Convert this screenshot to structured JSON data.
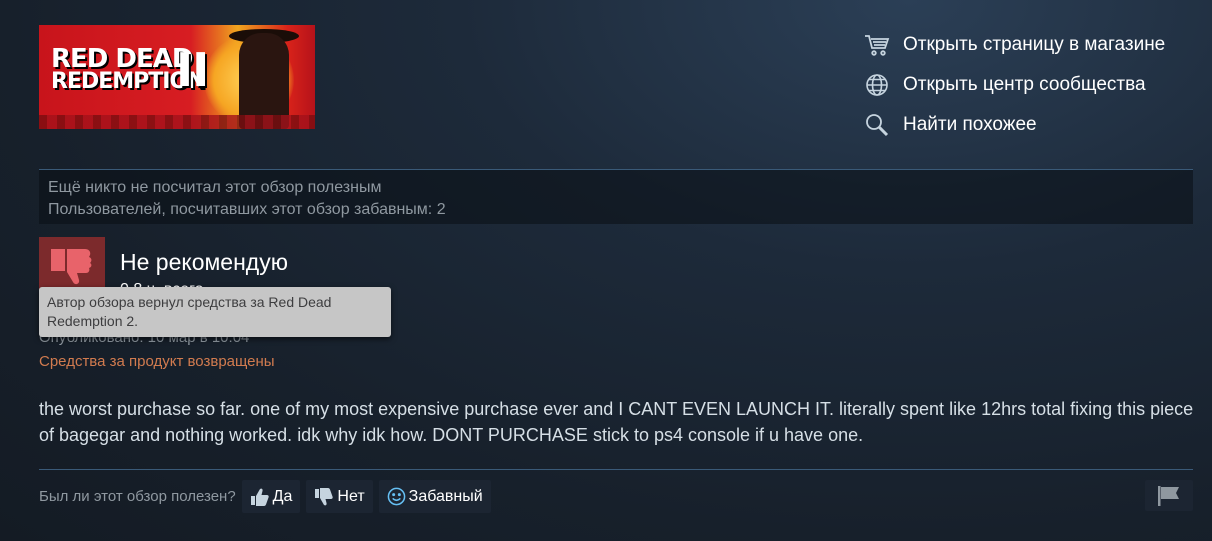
{
  "game": {
    "banner_line1": "RED DEAD",
    "banner_line2": "REDEMPTION",
    "banner_numeral": "II"
  },
  "links": [
    {
      "icon": "cart-icon",
      "label": "Открыть страницу в магазине"
    },
    {
      "icon": "globe-icon",
      "label": "Открыть центр сообщества"
    },
    {
      "icon": "search-icon",
      "label": "Найти похожее"
    }
  ],
  "votes": {
    "helpful_text": "Ещё никто не посчитал этот обзор полезным",
    "funny_text": "Пользователей, посчитавших этот обзор забавным: 2"
  },
  "review": {
    "thumb_icon": "thumbs-down-icon",
    "verdict": "Не рекомендую",
    "hours": "0.8 ч. всего",
    "posted": "Опубликовано: 10 мар в 10:04",
    "refunded": "Средства за продукт возвращены",
    "text": "the worst purchase so far. one of my most expensive purchase ever and I CANT EVEN LAUNCH IT. literally spent like 12hrs total fixing this piece of bagegar and nothing worked. idk why idk how. DONT PURCHASE stick to ps4 console if u have one."
  },
  "tooltip": {
    "text": "Автор обзора вернул средства за Red Dead Redemption 2."
  },
  "feedback": {
    "question": "Был ли этот обзор полезен?",
    "yes": "Да",
    "no": "Нет",
    "funny": "Забавный"
  },
  "colors": {
    "refund": "#d17b4f",
    "thumb_bg": "#7c2a2c",
    "link_text": "#ffffff"
  }
}
